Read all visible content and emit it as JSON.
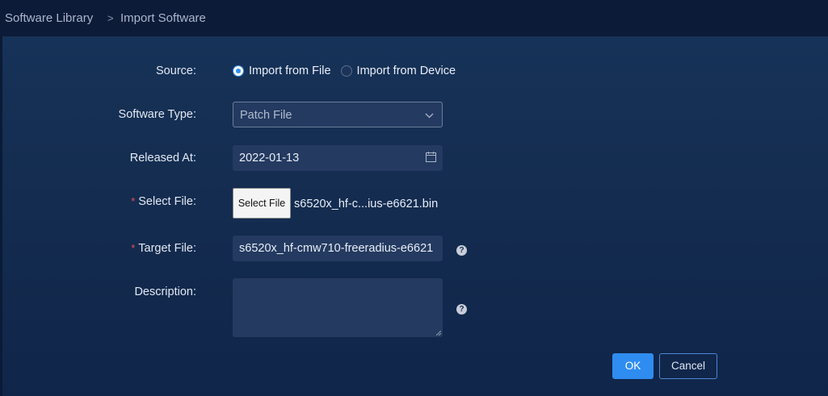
{
  "breadcrumb": {
    "root": "Software Library",
    "separator": ">",
    "current": "Import Software"
  },
  "form": {
    "source": {
      "label": "Source:",
      "options": [
        {
          "label": "Import from File",
          "selected": true
        },
        {
          "label": "Import from Device",
          "selected": false
        }
      ]
    },
    "software_type": {
      "label": "Software Type:",
      "value": "Patch File"
    },
    "released_at": {
      "label": "Released At:",
      "value": "2022-01-13"
    },
    "select_file": {
      "required_mark": "*",
      "label": "Select File:",
      "button_label": "Select File",
      "file_name": "s6520x_hf-c...ius-e6621.bin"
    },
    "target_file": {
      "required_mark": "*",
      "label": "Target File:",
      "value": "s6520x_hf-cmw710-freeradius-e6621"
    },
    "description": {
      "label": "Description:",
      "value": ""
    },
    "help_glyph": "?"
  },
  "actions": {
    "ok_label": "OK",
    "cancel_label": "Cancel"
  },
  "colors": {
    "accent": "#2f8cf0",
    "required": "#e0505a",
    "background": "#0b1a36"
  }
}
